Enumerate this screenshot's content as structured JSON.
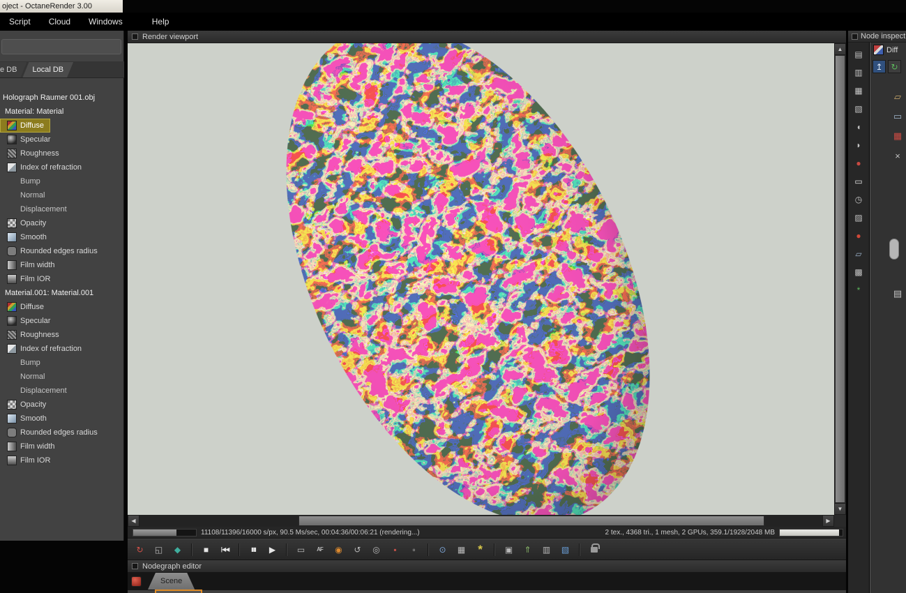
{
  "window": {
    "title": "oject - OctaneRender 3.00"
  },
  "menu": {
    "items": [
      {
        "label": "Script"
      },
      {
        "label": "Cloud"
      },
      {
        "label": "Windows"
      },
      {
        "label": "Help"
      }
    ]
  },
  "db_panel": {
    "tabs": [
      {
        "label": "e DB",
        "cls": "cut"
      },
      {
        "label": "Local DB",
        "cls": "active"
      }
    ],
    "tree": [
      {
        "label": "Holograph Raumer 001.obj",
        "cls": "t-header",
        "icon": "no-icon"
      },
      {
        "label": "Material: Material",
        "cls": "t-sub",
        "icon": "no-icon"
      },
      {
        "label": "Diffuse",
        "cls": "selected",
        "icon": "diffuse-icon"
      },
      {
        "label": "Specular",
        "cls": "",
        "icon": "specular-icon"
      },
      {
        "label": "Roughness",
        "cls": "",
        "icon": "roughness-icon"
      },
      {
        "label": "Index of refraction",
        "cls": "",
        "icon": "ior-icon"
      },
      {
        "label": "Bump",
        "cls": "empty",
        "icon": "no-icon"
      },
      {
        "label": "Normal",
        "cls": "empty",
        "icon": "no-icon"
      },
      {
        "label": "Displacement",
        "cls": "empty",
        "icon": "no-icon"
      },
      {
        "label": "Opacity",
        "cls": "",
        "icon": "opacity-icon"
      },
      {
        "label": "Smooth",
        "cls": "",
        "icon": "smooth-icon"
      },
      {
        "label": "Rounded edges radius",
        "cls": "",
        "icon": "rounded-edges-icon"
      },
      {
        "label": "Film width",
        "cls": "",
        "icon": "film-width-icon"
      },
      {
        "label": "Film IOR",
        "cls": "",
        "icon": "film-ior-icon"
      },
      {
        "label": "Material.001: Material.001",
        "cls": "t-sub",
        "icon": "no-icon"
      },
      {
        "label": "Diffuse",
        "cls": "",
        "icon": "diffuse-icon"
      },
      {
        "label": "Specular",
        "cls": "",
        "icon": "specular-icon"
      },
      {
        "label": "Roughness",
        "cls": "",
        "icon": "roughness-icon"
      },
      {
        "label": "Index of refraction",
        "cls": "",
        "icon": "ior-icon"
      },
      {
        "label": "Bump",
        "cls": "empty",
        "icon": "no-icon"
      },
      {
        "label": "Normal",
        "cls": "empty",
        "icon": "no-icon"
      },
      {
        "label": "Displacement",
        "cls": "empty",
        "icon": "no-icon"
      },
      {
        "label": "Opacity",
        "cls": "",
        "icon": "opacity-icon"
      },
      {
        "label": "Smooth",
        "cls": "",
        "icon": "smooth-icon"
      },
      {
        "label": "Rounded edges radius",
        "cls": "",
        "icon": "rounded-edges-icon"
      },
      {
        "label": "Film width",
        "cls": "",
        "icon": "film-width-icon"
      },
      {
        "label": "Film IOR",
        "cls": "",
        "icon": "film-ior-icon"
      }
    ]
  },
  "viewport": {
    "title": "Render viewport",
    "progress_pct": 69,
    "status_left": "11108/11396/16000 s/px, 90.5 Ms/sec, 00:04:36/00:06:21 (rendering...)",
    "status_right": "2 tex., 4368 tri., 1 mesh, 2 GPUs, 359.1/1928/2048 MB",
    "vram_pct": 94
  },
  "scroll": {
    "up": "▲",
    "down": "▼",
    "left": "◀",
    "right": "▶"
  },
  "toolbar": {
    "items": [
      {
        "name": "restart-render-icon",
        "glyph": "↻",
        "color": "#d05048"
      },
      {
        "name": "fit-viewport-icon",
        "glyph": "◱",
        "color": "#b8b8b8"
      },
      {
        "name": "preview-cube-icon",
        "glyph": "◆",
        "color": "#3fae9e"
      },
      {
        "cls": "sep",
        "inter": "false"
      },
      {
        "name": "stop-render-icon",
        "glyph": "■",
        "color": "#e6e6e6"
      },
      {
        "name": "restart-frame-icon",
        "glyph": "|◀◀",
        "color": "#e6e6e6",
        "cls": "small"
      },
      {
        "cls": "sep",
        "inter": "false"
      },
      {
        "name": "pause-render-icon",
        "glyph": "▮▮",
        "color": "#e6e6e6",
        "cls": "small"
      },
      {
        "name": "resume-render-icon",
        "glyph": "▶",
        "color": "#e6e6e6"
      },
      {
        "cls": "sep",
        "inter": "false"
      },
      {
        "name": "fullscreen-icon",
        "glyph": "▭",
        "color": "#b8b8b8"
      },
      {
        "name": "autofocus-icon",
        "glyph": "AF",
        "color": "#b8b8b8",
        "cls": "small"
      },
      {
        "name": "focus-picker-icon",
        "glyph": "◉",
        "color": "#dd8a2f"
      },
      {
        "name": "white-balance-picker-icon",
        "glyph": "↺",
        "color": "#b8b8b8"
      },
      {
        "name": "camera-reset-icon",
        "glyph": "◎",
        "color": "#b8b8b8"
      },
      {
        "name": "render-region-icon",
        "glyph": "▪",
        "color": "#c25048"
      },
      {
        "name": "film-region-icon",
        "glyph": "▫",
        "color": "#b8b8b8"
      },
      {
        "cls": "sep",
        "inter": "false"
      },
      {
        "name": "material-picker-icon",
        "glyph": "⊙",
        "color": "#7da6d8"
      },
      {
        "name": "background-alpha-icon",
        "glyph": "▦",
        "color": "#b8b8b8"
      },
      {
        "name": "render-priority-icon",
        "glyph": "*",
        "color": "#d9c84a",
        "cls": "big"
      },
      {
        "cls": "sep",
        "inter": "false"
      },
      {
        "name": "copy-image-icon",
        "glyph": "▣",
        "color": "#b8b8b8"
      },
      {
        "name": "save-image-icon",
        "glyph": "⇑",
        "color": "#8ab86a"
      },
      {
        "name": "save-buffer-icon",
        "glyph": "▥",
        "color": "#b8b8b8"
      },
      {
        "name": "export-pass-icon",
        "glyph": "▧",
        "color": "#6a9fd8"
      },
      {
        "cls": "sep",
        "inter": "false"
      },
      {
        "name": "lock-icon",
        "glyph": "",
        "color": "#9a9a9a"
      }
    ]
  },
  "node_palette": {
    "items": [
      {
        "name": "copy-node-icon",
        "glyph": "▤",
        "color": "#c2c2c2"
      },
      {
        "name": "duplicate-node-icon",
        "glyph": "▥",
        "color": "#c2c2c2"
      },
      {
        "name": "texture-image-icon",
        "glyph": "▦",
        "color": "#c2c2c2"
      },
      {
        "name": "image-adjust-icon",
        "glyph": "▧",
        "color": "#c2c2c2"
      },
      {
        "name": "mesh-node-icon",
        "glyph": "◖",
        "color": "#c2c2c2"
      },
      {
        "name": "mesh-preview-icon",
        "glyph": "◗",
        "color": "#c2c2c2"
      },
      {
        "name": "material-ball-icon",
        "glyph": "●",
        "color": "#c84a42"
      },
      {
        "name": "texture-generator-icon",
        "glyph": "▭",
        "color": "#e2e2e2"
      },
      {
        "name": "animation-time-icon",
        "glyph": "◷",
        "color": "#c2c2c2"
      },
      {
        "name": "projection-node-icon",
        "glyph": "▨",
        "color": "#c2c2c2"
      },
      {
        "name": "render-target-icon",
        "glyph": "●",
        "color": "#d04838"
      },
      {
        "name": "render-layer-icon",
        "glyph": "▱",
        "color": "#9ab0c8"
      },
      {
        "name": "image-output-icon",
        "glyph": "▩",
        "color": "#c2c2c2"
      },
      {
        "name": "scatter-node-icon",
        "glyph": "*",
        "color": "#5cb85c"
      }
    ]
  },
  "inspector": {
    "title": "Node inspect",
    "node_label": "Diff",
    "buttons": [
      {
        "name": "import-node-icon",
        "glyph": "↥",
        "color": "#dce8f8"
      },
      {
        "name": "refresh-node-icon",
        "glyph": "↻",
        "color": "#5cb85c"
      }
    ],
    "side_icons": [
      {
        "name": "folder-icon",
        "glyph": "▱",
        "color": "#c9a86b"
      },
      {
        "name": "monitor-icon",
        "glyph": "▭",
        "color": "#9fb6cc"
      },
      {
        "name": "grid-red-icon",
        "glyph": "▦",
        "color": "#c84a42"
      },
      {
        "name": "delete-icon",
        "glyph": "×",
        "color": "#c2c2c2"
      },
      {
        "name": "list-icon",
        "glyph": "▤",
        "color": "#c2c2c2"
      }
    ]
  },
  "nodegraph": {
    "title": "Nodegraph editor",
    "scene_tab": "Scene"
  }
}
